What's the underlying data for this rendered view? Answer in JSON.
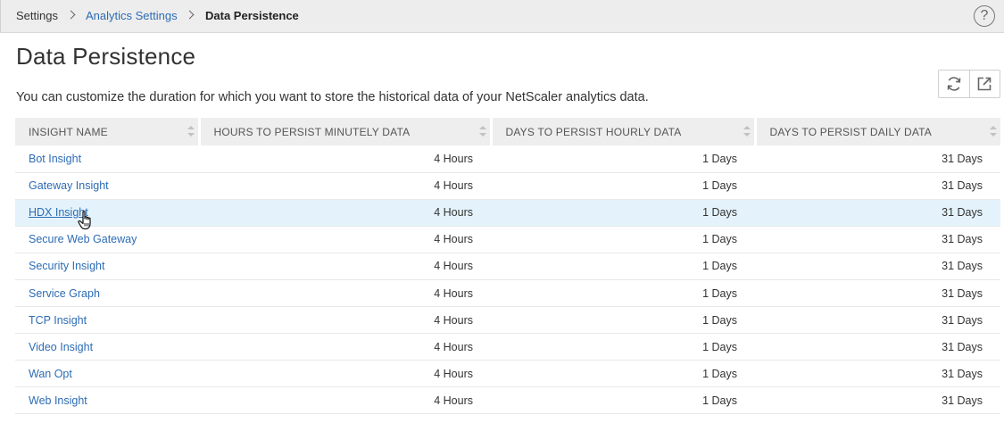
{
  "breadcrumb": {
    "items": [
      "Settings",
      "Analytics Settings",
      "Data Persistence"
    ]
  },
  "help": {
    "label": "?"
  },
  "page": {
    "title": "Data Persistence",
    "description": "You can customize the duration for which you want to store the historical data of your NetScaler analytics data."
  },
  "toolbar": {
    "refresh_icon": "refresh-icon",
    "export_icon": "external-link-icon"
  },
  "table": {
    "headers": [
      "INSIGHT NAME",
      "HOURS TO PERSIST MINUTELY DATA",
      "DAYS TO PERSIST HOURLY DATA",
      "DAYS TO PERSIST DAILY DATA"
    ],
    "highlighted_row": 2,
    "rows": [
      {
        "name": "Bot Insight",
        "minutely": "4 Hours",
        "hourly": "1 Days",
        "daily": "31 Days"
      },
      {
        "name": "Gateway Insight",
        "minutely": "4 Hours",
        "hourly": "1 Days",
        "daily": "31 Days"
      },
      {
        "name": "HDX Insight",
        "minutely": "4 Hours",
        "hourly": "1 Days",
        "daily": "31 Days"
      },
      {
        "name": "Secure Web Gateway",
        "minutely": "4 Hours",
        "hourly": "1 Days",
        "daily": "31 Days"
      },
      {
        "name": "Security Insight",
        "minutely": "4 Hours",
        "hourly": "1 Days",
        "daily": "31 Days"
      },
      {
        "name": "Service Graph",
        "minutely": "4 Hours",
        "hourly": "1 Days",
        "daily": "31 Days"
      },
      {
        "name": "TCP Insight",
        "minutely": "4 Hours",
        "hourly": "1 Days",
        "daily": "31 Days"
      },
      {
        "name": "Video Insight",
        "minutely": "4 Hours",
        "hourly": "1 Days",
        "daily": "31 Days"
      },
      {
        "name": "Wan Opt",
        "minutely": "4 Hours",
        "hourly": "1 Days",
        "daily": "31 Days"
      },
      {
        "name": "Web Insight",
        "minutely": "4 Hours",
        "hourly": "1 Days",
        "daily": "31 Days"
      }
    ]
  },
  "colors": {
    "link": "#2d6cb5",
    "row_highlight": "#e4f3fb",
    "header_bg": "#eeeeee",
    "topbar_bg": "#ededed"
  }
}
